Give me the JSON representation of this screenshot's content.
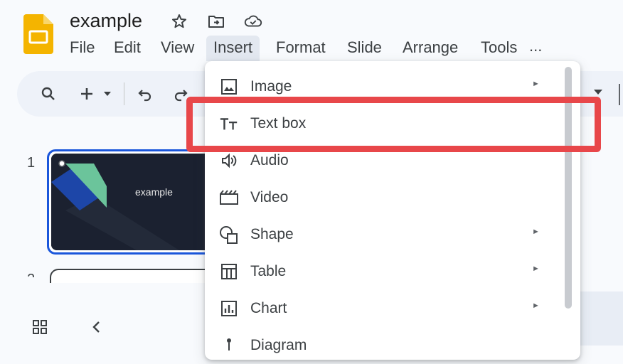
{
  "document": {
    "title": "example"
  },
  "menubar": {
    "items": [
      {
        "id": "file",
        "label": "File"
      },
      {
        "id": "edit",
        "label": "Edit"
      },
      {
        "id": "view",
        "label": "View"
      },
      {
        "id": "insert",
        "label": "Insert"
      },
      {
        "id": "format",
        "label": "Format"
      },
      {
        "id": "slide",
        "label": "Slide"
      },
      {
        "id": "arrange",
        "label": "Arrange"
      },
      {
        "id": "tools",
        "label": "Tools"
      }
    ],
    "more": "..."
  },
  "filmstrip": {
    "slides": [
      {
        "number": "1",
        "title": "example"
      },
      {
        "number": "2"
      }
    ]
  },
  "insert_menu": {
    "items": [
      {
        "label": "Image",
        "icon": "image-icon",
        "submenu": true
      },
      {
        "label": "Text box",
        "icon": "text-box-icon",
        "submenu": false
      },
      {
        "label": "Audio",
        "icon": "audio-icon",
        "submenu": false
      },
      {
        "label": "Video",
        "icon": "video-icon",
        "submenu": false
      },
      {
        "label": "Shape",
        "icon": "shape-icon",
        "submenu": true
      },
      {
        "label": "Table",
        "icon": "table-icon",
        "submenu": true
      },
      {
        "label": "Chart",
        "icon": "chart-icon",
        "submenu": true
      },
      {
        "label": "Diagram",
        "icon": "diagram-icon",
        "submenu": false
      }
    ],
    "submenu_arrow": "►"
  },
  "colors": {
    "highlight": "#e8474a",
    "selection": "#1a56db",
    "slides_logo": "#f4b400"
  }
}
